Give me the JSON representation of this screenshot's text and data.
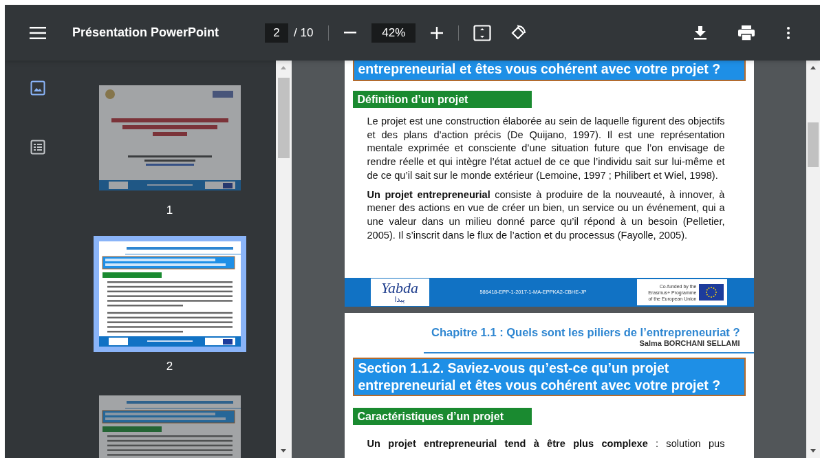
{
  "toolbar": {
    "title": "Présentation PowerPoint",
    "page_current": "2",
    "page_total": "/ 10",
    "zoom": "42%"
  },
  "sidebar": {
    "views": [
      {
        "kind": "thumbnails",
        "selected": true
      },
      {
        "kind": "outline",
        "selected": false
      }
    ],
    "thumbnails": [
      {
        "kind": "title",
        "label": "1",
        "selected": false
      },
      {
        "kind": "content",
        "label": "2",
        "selected": true
      },
      {
        "kind": "content",
        "selected": false
      }
    ]
  },
  "pages": [
    {
      "section_heading": "entrepreneurial et êtes vous cohérent avec votre projet ?",
      "subheading": "Définition d’un projet",
      "paragraphs": [
        "Le projet est une construction élaborée au sein de laquelle figurent des objectifs et des plans d’action précis (De Quijano, 1997). Il est une représentation mentale exprimée et consciente d’une situation future que l’on envisage de rendre réelle et qui intègre l’état actuel de ce que l’individu sait sur lui-même et de ce qu’il sait sur le monde extérieur (Lemoine, 1997 ; Philibert et Wiel, 1998).",
        "**Un projet entrepreneurial** consiste à produire de la nouveauté, à innover, à mener des actions en vue de créer un bien, un service ou un événement, qui a une valeur dans un milieu  donné parce qu’il répond à un besoin (Pelletier, 2005). Il s’inscrit dans le flux de l’action et du processus (Fayolle, 2005)."
      ],
      "footer": {
        "logo_latin": "Yabda",
        "logo_arabic": "يبدا",
        "code": "586418-EPP-1-2017-1-MA-EPPKA2-CBHE-JP",
        "cofunded_lines": [
          "Co-funded by the",
          "Erasmus+ Programme",
          "of the European Union"
        ]
      }
    },
    {
      "chapter": "Chapitre 1.1 : Quels sont les piliers de l’entrepreneuriat ?",
      "author": "Salma BORCHANI SELLAMI",
      "section_heading": "Section 1.1.2. Saviez-vous qu’est-ce qu’un projet entrepreneurial et êtes vous cohérent avec votre projet ?",
      "subheading": "Caractéristiques  d’un projet",
      "paragraphs": [
        "**Un projet entrepreneurial tend à être plus complexe** : solution pus"
      ]
    }
  ]
}
